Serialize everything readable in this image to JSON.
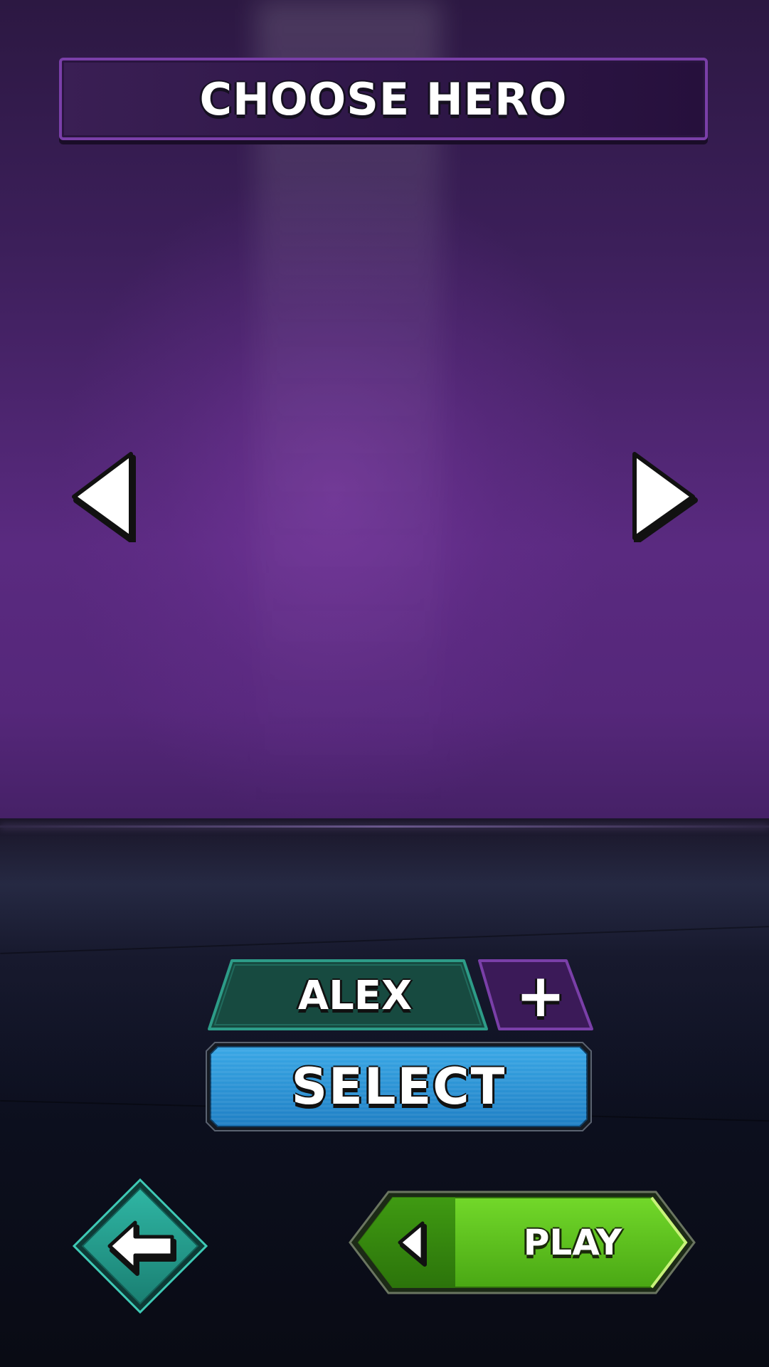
{
  "header": {
    "title": "CHOOSE HERO"
  },
  "carousel": {
    "prev_icon": "triangle-left-icon",
    "next_icon": "triangle-right-icon"
  },
  "hero": {
    "name": "ALEX",
    "add_label": "+"
  },
  "actions": {
    "select_label": "SELECT",
    "back_icon": "arrow-left-icon",
    "play_label": "PLAY",
    "play_icon": "triangle-left-icon"
  },
  "colors": {
    "background": "#5a2a80",
    "title_border": "#7a3fa8",
    "name_tab": "#1d5a4c",
    "plus_tab": "#3b1a58",
    "select": "#2a8fd0",
    "back": "#2aa596",
    "play": "#5fcb1e"
  }
}
